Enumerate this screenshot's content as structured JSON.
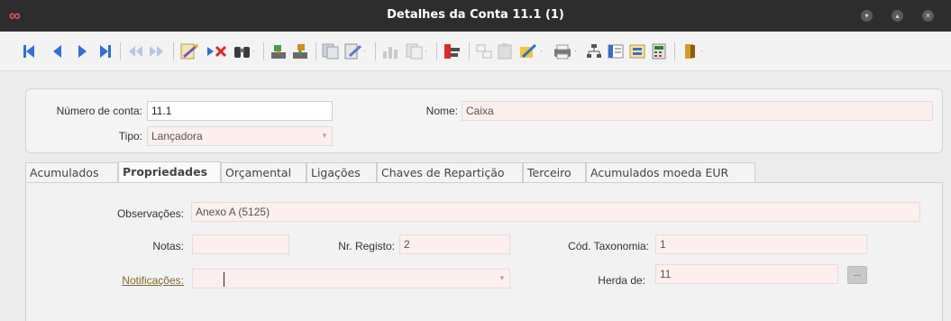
{
  "window": {
    "title": "Detalhes da Conta 11.1 (1)",
    "logo": "∞"
  },
  "controls": {
    "minimize": "▾",
    "maximize": "▴",
    "close": "✕"
  },
  "toolbar": {
    "icons": [
      "first-record-icon",
      "previous-record-icon",
      "next-record-icon",
      "last-record-icon",
      "back-forward-icon",
      "edit-wand-icon",
      "delete-icon",
      "search-binoculars-icon",
      "import-icon",
      "export-icon",
      "duplicate-icon",
      "edit-document-icon",
      "chart-icon",
      "copy-icon",
      "report-icon",
      "cut-icon",
      "paste-icon",
      "magic-wand-icon",
      "print-icon",
      "tree-icon",
      "list-icon",
      "form-icon",
      "calculator-icon",
      "exit-door-icon"
    ]
  },
  "header": {
    "account_number_label": "Número de conta:",
    "account_number_value": "11.1",
    "name_label": "Nome:",
    "name_value": "Caixa",
    "type_label": "Tipo:",
    "type_value": "Lançadora"
  },
  "tabs": [
    {
      "label": "Acumulados"
    },
    {
      "label": "Propriedades"
    },
    {
      "label": "Orçamental"
    },
    {
      "label": "Ligações"
    },
    {
      "label": "Chaves de Repartição"
    },
    {
      "label": "Terceiro"
    },
    {
      "label": "Acumulados moeda EUR"
    }
  ],
  "properties": {
    "observations_label": "Observações:",
    "observations_value": "Anexo A (5125)",
    "notes_label": "Notas:",
    "notes_value": "",
    "registry_label": "Nr. Registo:",
    "registry_value": "2",
    "taxonomy_label": "Cód. Taxonomia:",
    "taxonomy_value": "1",
    "notifications_label": "Notificações:",
    "notifications_value": "",
    "inherits_label": "Herda de:",
    "inherits_value": "11",
    "inherits_button": "..."
  }
}
